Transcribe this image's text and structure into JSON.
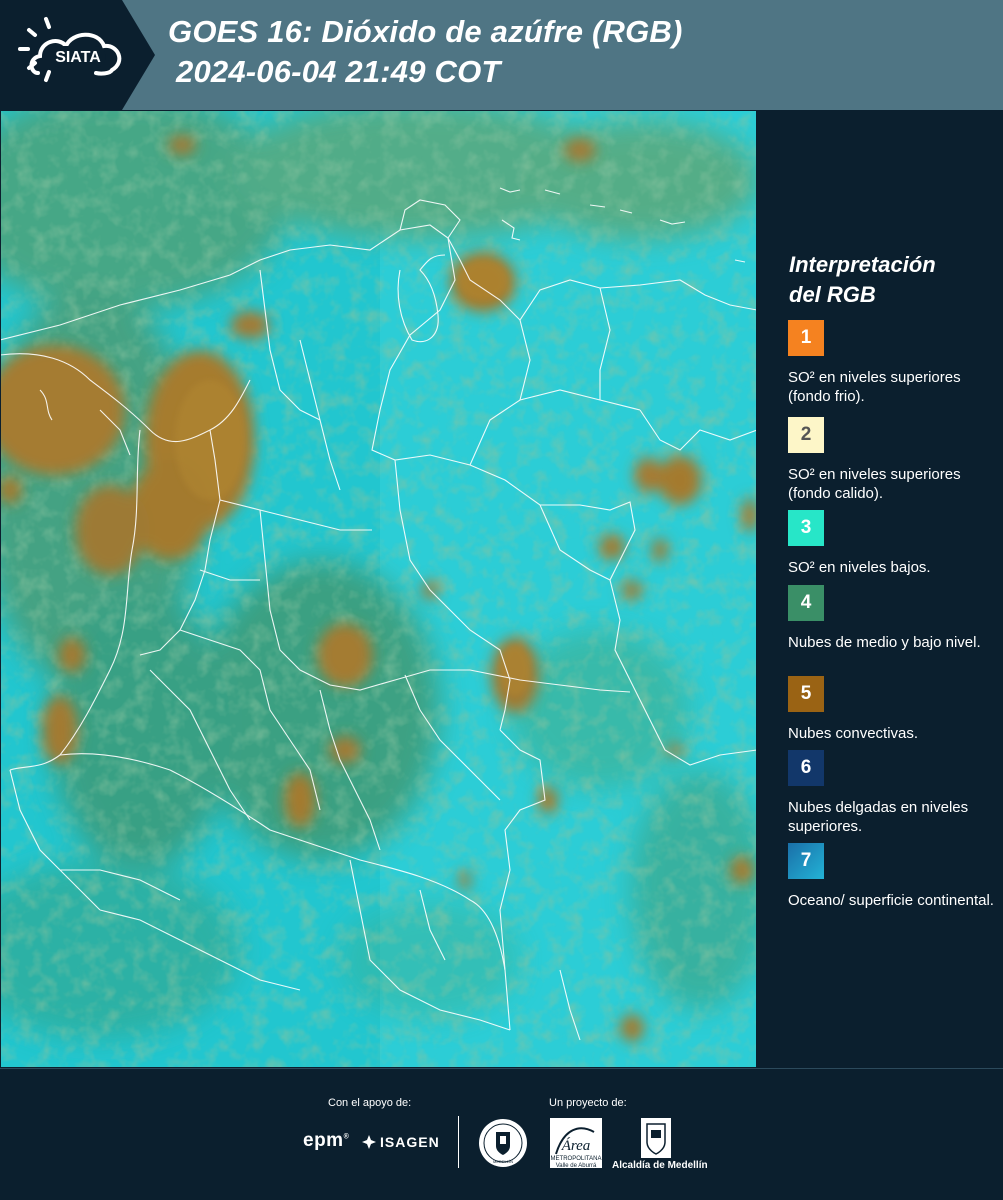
{
  "header": {
    "logo_text": "SIATA",
    "title_line1": "GOES 16: Dióxido de azúfre (RGB)",
    "title_line2": "2024-06-04 21:49 COT"
  },
  "legend": {
    "title_line1": "Interpretación",
    "title_line2": "del RGB",
    "items": [
      {
        "number": "1",
        "color": "#f58220",
        "label": "SO² en niveles superiores (fondo frio)."
      },
      {
        "number": "2",
        "color": "#fdf6c8",
        "label": "SO² en niveles superiores (fondo calido)."
      },
      {
        "number": "3",
        "color": "#27e6c8",
        "label": "SO² en niveles bajos."
      },
      {
        "number": "4",
        "color": "#3a8f67",
        "label": "Nubes de medio y bajo nivel."
      },
      {
        "number": "5",
        "color": "#9a6314",
        "label": "Nubes convectivas."
      },
      {
        "number": "6",
        "color": "#12376a",
        "label": "Nubes delgadas en niveles superiores."
      },
      {
        "number": "7",
        "color": "#1c93c6",
        "label": "Oceano/ superficie continental."
      }
    ]
  },
  "footer": {
    "support_label": "Con el apoyo de:",
    "project_label": "Un proyecto de:",
    "sponsor1": "epm",
    "sponsor2": "ISAGEN",
    "seal_text": "MEDELLÍN",
    "area_name": "Área",
    "area_subtitle": "METROPOLITANA Valle de Aburrá",
    "alcaldia": "Alcaldía de Medellín"
  },
  "colors": {
    "header_bg": "#4f7584",
    "panel_bg": "#0b1f2e",
    "map_base": "#1fc4cc",
    "cloud_brown": "#a07a2a",
    "cloud_green": "#3f9a6a"
  }
}
